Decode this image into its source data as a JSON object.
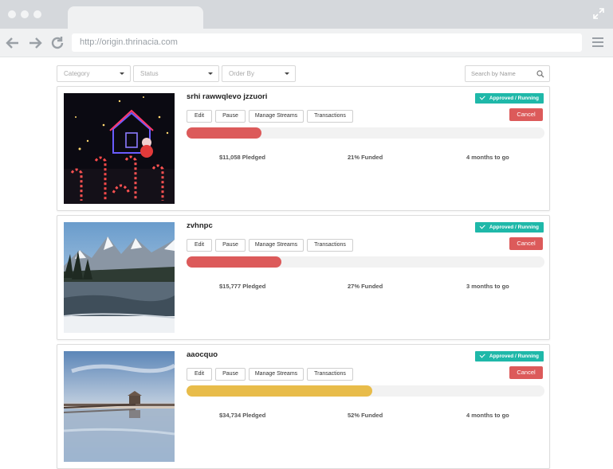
{
  "browser": {
    "url": "http://origin.thrinacia.com",
    "icons": [
      "back-arrow-icon",
      "forward-arrow-icon",
      "reload-icon",
      "hamburger-menu-icon",
      "expand-icon"
    ]
  },
  "filters": {
    "category_label": "Category",
    "status_label": "Status",
    "order_label": "Order By",
    "search_placeholder": "Search by Name"
  },
  "campaigns": [
    {
      "title": "srhi rawwqlevo jzzuori",
      "status": "Approved / Running",
      "buttons": {
        "edit": "Edit",
        "pause": "Pause",
        "manage": "Manage Streams",
        "transactions": "Transactions"
      },
      "cancel": "Cancel",
      "progress_fraction": 0.21,
      "bar_color": "#dc5a5a",
      "pledged": "$11,058 Pledged",
      "funded": "21% Funded",
      "time_left": "4 months to go",
      "image": "christmas-lights-house"
    },
    {
      "title": "zvhnpc",
      "status": "Approved / Running",
      "buttons": {
        "edit": "Edit",
        "pause": "Pause",
        "manage": "Manage Streams",
        "transactions": "Transactions"
      },
      "cancel": "Cancel",
      "progress_fraction": 0.265,
      "bar_color": "#dc5a5a",
      "pledged": "$15,777 Pledged",
      "funded": "27% Funded",
      "time_left": "3 months to go",
      "image": "snowy-mountain-lake"
    },
    {
      "title": "aaocquo",
      "status": "Approved / Running",
      "buttons": {
        "edit": "Edit",
        "pause": "Pause",
        "manage": "Manage Streams",
        "transactions": "Transactions"
      },
      "cancel": "Cancel",
      "progress_fraction": 0.52,
      "bar_color": "#e8bc4a",
      "pledged": "$34,734 Pledged",
      "funded": "52% Funded",
      "time_left": "4 months to go",
      "image": "pier-sunset-reflection"
    }
  ]
}
